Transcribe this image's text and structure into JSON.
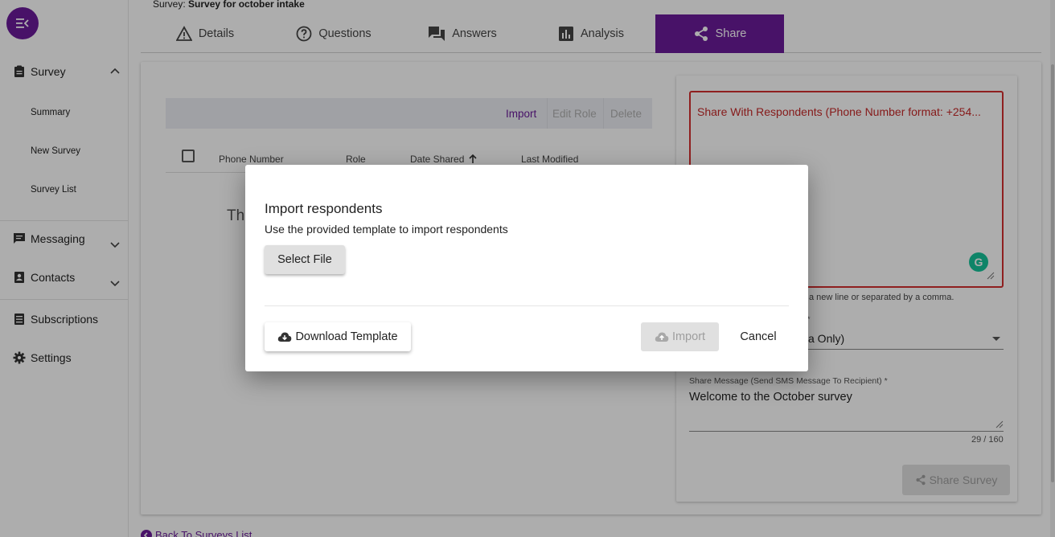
{
  "header": {
    "survey_prefix": "Survey:",
    "survey_name": "Survey for october intake"
  },
  "sidebar": {
    "survey": "Survey",
    "sub_items": [
      "Summary",
      "New Survey",
      "Survey List"
    ],
    "messaging": "Messaging",
    "contacts": "Contacts",
    "subscriptions": "Subscriptions",
    "settings": "Settings"
  },
  "tabs": [
    {
      "label": "Details",
      "icon": "warning-icon"
    },
    {
      "label": "Questions",
      "icon": "help-circle-icon"
    },
    {
      "label": "Answers",
      "icon": "forum-icon"
    },
    {
      "label": "Analysis",
      "icon": "bar-chart-icon"
    },
    {
      "label": "Share",
      "icon": "share-icon",
      "active": true
    }
  ],
  "toolbar": {
    "import": "Import",
    "edit_role": "Edit Role",
    "delete": "Delete"
  },
  "table": {
    "columns": [
      "Phone Number",
      "Role",
      "Date Shared",
      "Last Modified"
    ],
    "empty_partial": "Th"
  },
  "share_panel": {
    "phone_label": "Share With Respondents (Phone Number format: +254...",
    "hint": "a new line or separated by a comma.",
    "role_label_partial": "*",
    "role_value_partial": "a Only)",
    "message_label": "Share Message (Send SMS Message To Recipient) *",
    "message_value": "Welcome to the October survey",
    "counter": "29 / 160",
    "share_button": "Share Survey"
  },
  "back_link": "Back To Surveys List",
  "dialog": {
    "title": "Import respondents",
    "subtitle": "Use the provided template to import respondents",
    "select_file": "Select File",
    "download_template": "Download Template",
    "import": "Import",
    "cancel": "Cancel"
  },
  "colors": {
    "accent": "#6a1b9a",
    "error": "#d32f2f",
    "grammarly": "#15c39a"
  }
}
